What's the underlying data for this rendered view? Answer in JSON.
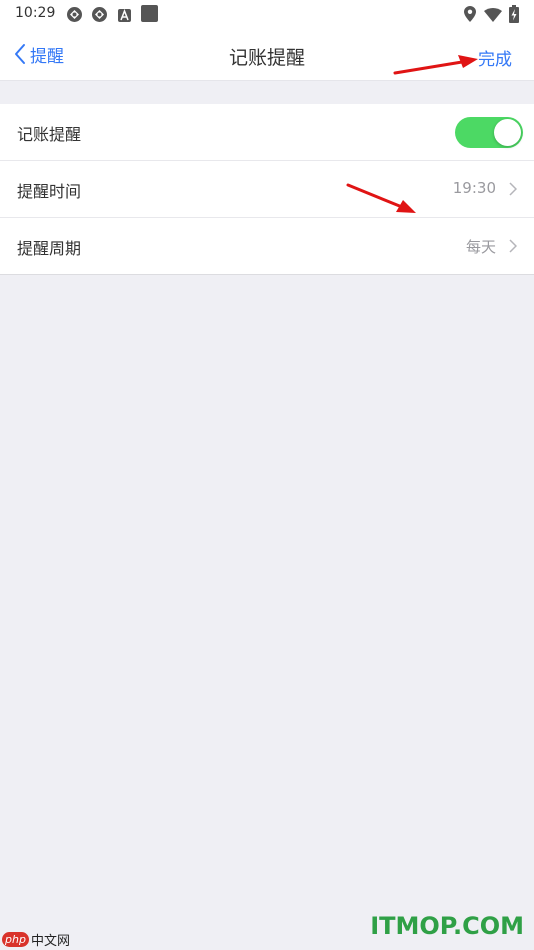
{
  "status_bar": {
    "time": "10:29",
    "icons": [
      "sync-icon",
      "sync-icon",
      "font-a-icon",
      "square-icon",
      "location-icon",
      "wifi-icon",
      "battery-charging-icon"
    ]
  },
  "nav": {
    "back_label": "提醒",
    "title": "记账提醒",
    "done_label": "完成"
  },
  "rows": [
    {
      "label": "记账提醒",
      "control": "toggle",
      "enabled": true
    },
    {
      "label": "提醒时间",
      "value": "19:30"
    },
    {
      "label": "提醒周期",
      "value": "每天"
    }
  ],
  "colors": {
    "accent": "#3478f6",
    "toggle_on": "#4cd964",
    "background": "#efeff4",
    "annotation_arrow": "#e01414"
  },
  "watermarks": {
    "left_badge": "php",
    "left_text": "中文网",
    "right_text": "ITMOP.COM"
  }
}
